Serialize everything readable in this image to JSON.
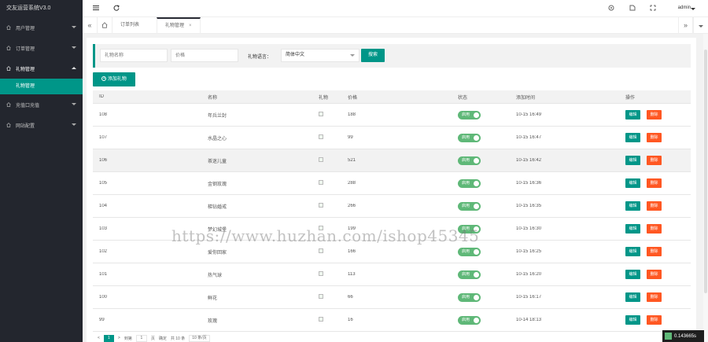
{
  "app": {
    "title": "交友运营系统V3.0"
  },
  "sidebar": {
    "items": [
      {
        "label": "用户管理",
        "icon": "home-icon"
      },
      {
        "label": "订单管理",
        "icon": "home-icon"
      },
      {
        "label": "礼物管理",
        "icon": "home-icon",
        "expanded": true,
        "children": [
          {
            "label": "礼物管理"
          }
        ]
      },
      {
        "label": "充值口充值",
        "icon": "home-icon"
      },
      {
        "label": "网站配置",
        "icon": "home-icon"
      }
    ]
  },
  "header": {
    "user": "admin"
  },
  "tabs": [
    {
      "label": "订单列表"
    },
    {
      "label": "礼物管理",
      "close": "×"
    }
  ],
  "filter": {
    "name_placeholder": "礼物名称",
    "price_placeholder": "价格",
    "lang_label": "礼物语言：",
    "lang_value": "简体中文",
    "search_label": "搜索"
  },
  "add_button": "添加礼物",
  "table": {
    "headers": {
      "id": "ID",
      "name": "名称",
      "pic": "礼物",
      "price": "价格",
      "status": "状态",
      "time": "添加时间",
      "ops": "操作"
    },
    "toggle_label": "启用",
    "edit_label": "编辑",
    "delete_label": "删除",
    "rows": [
      {
        "id": "108",
        "name": "年兵兰封",
        "price": "188",
        "time": "10-15 16:49"
      },
      {
        "id": "107",
        "name": "水晶之心",
        "price": "99",
        "time": "10-15 16:47"
      },
      {
        "id": "106",
        "name": "茶迷儿童",
        "price": "521",
        "time": "10-15 16:42"
      },
      {
        "id": "105",
        "name": "金钢玫瑰",
        "price": "288",
        "time": "10-15 16:36"
      },
      {
        "id": "104",
        "name": "梯钻婚戒",
        "price": "266",
        "time": "10-15 16:35"
      },
      {
        "id": "103",
        "name": "梦幻城堡",
        "price": "199",
        "time": "10-15 16:30"
      },
      {
        "id": "102",
        "name": "爱你回家",
        "price": "166",
        "time": "10-15 16:25"
      },
      {
        "id": "101",
        "name": "热气球",
        "price": "113",
        "time": "10-15 16:20"
      },
      {
        "id": "100",
        "name": "鲜花",
        "price": "66",
        "time": "10-15 16:17"
      },
      {
        "id": "99",
        "name": "玫瑰",
        "price": "16",
        "time": "10-14 18:13"
      }
    ]
  },
  "pager": {
    "current": "1",
    "goto_label": "到第",
    "goto_value": "1",
    "page_unit": "页",
    "confirm": "确定",
    "total": "共 10 条",
    "size": "10 条/页"
  },
  "watermark": "https://www.huzhan.com/ishop45345",
  "perf": "0.143665s",
  "colors": {
    "accent": "#009688",
    "danger": "#ff5722",
    "toggle": "#5fb878",
    "sidebar": "#23262e"
  }
}
